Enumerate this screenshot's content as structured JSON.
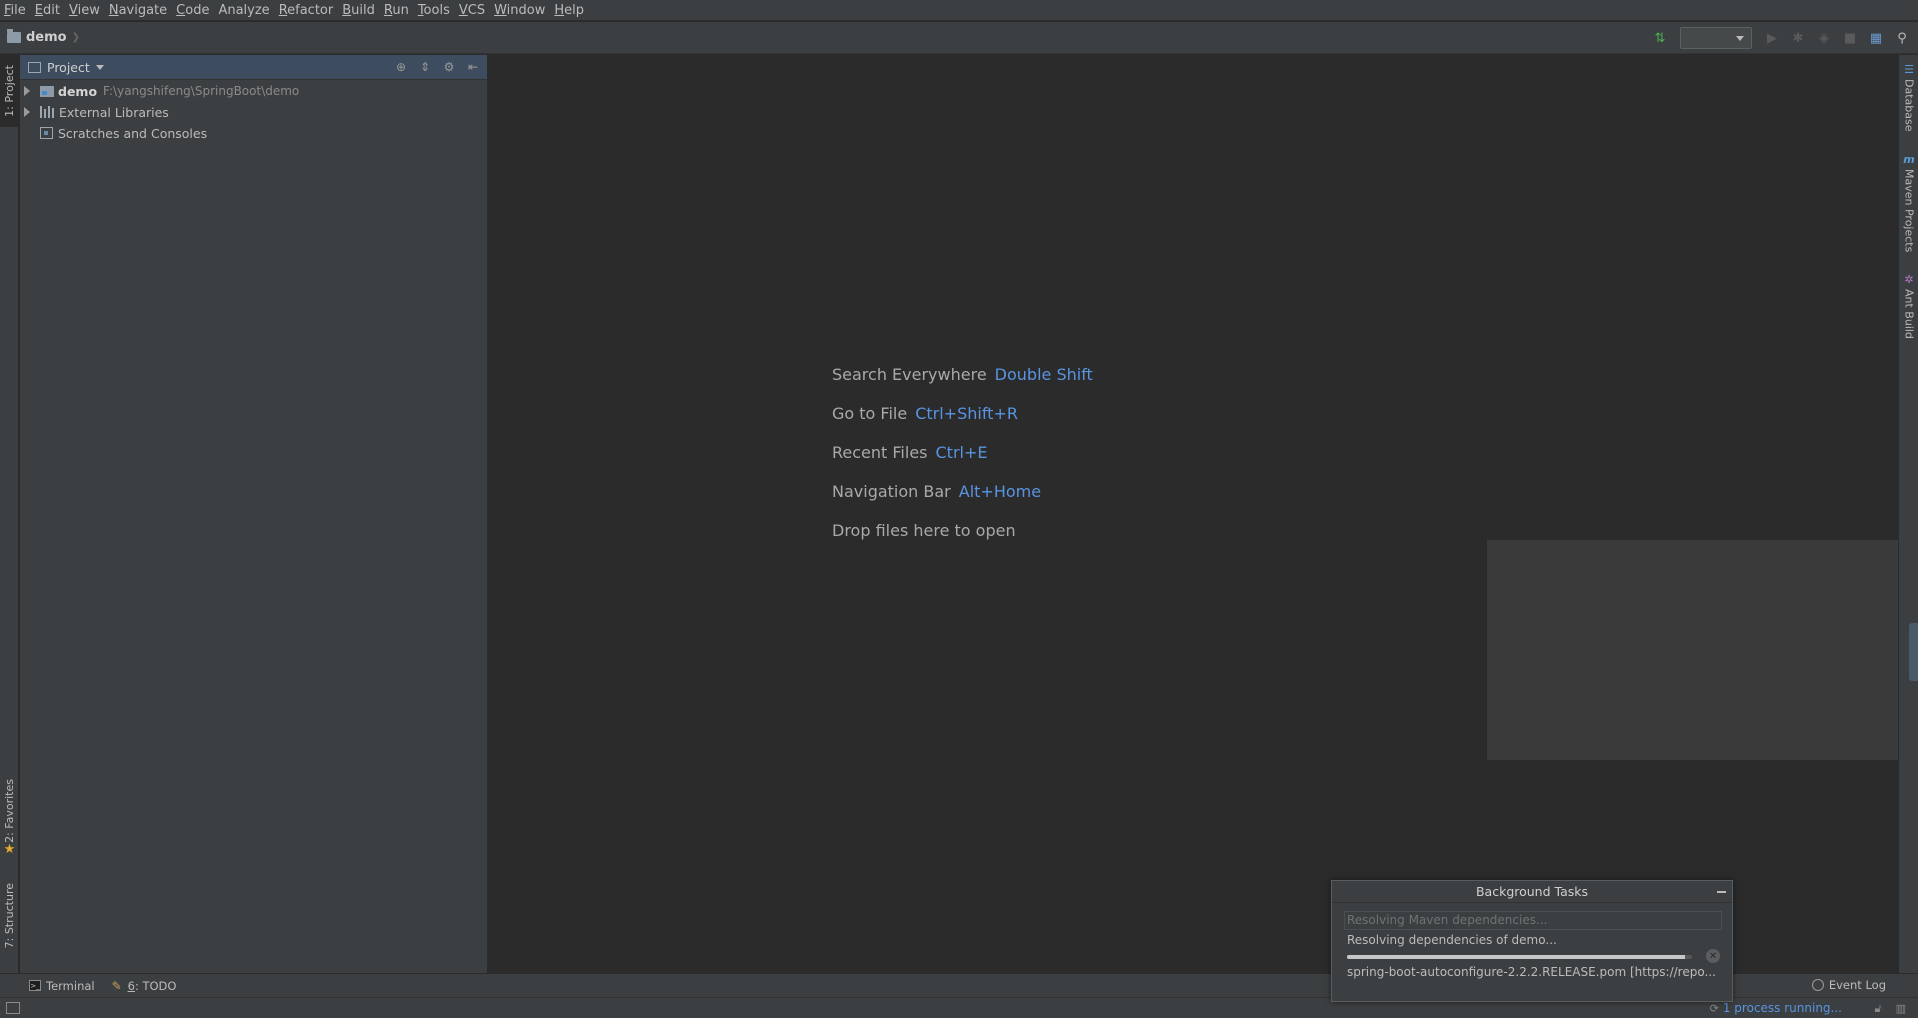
{
  "menu": {
    "items": [
      {
        "key": "F",
        "rest": "ile"
      },
      {
        "key": "E",
        "rest": "dit"
      },
      {
        "key": "V",
        "rest": "iew"
      },
      {
        "key": "N",
        "rest": "avigate"
      },
      {
        "key": "C",
        "rest": "ode"
      },
      {
        "key": "",
        "rest": "Analyze"
      },
      {
        "key": "R",
        "rest": "efactor"
      },
      {
        "key": "B",
        "rest": "uild"
      },
      {
        "key": "R",
        "rest": "un"
      },
      {
        "key": "T",
        "rest": "ools"
      },
      {
        "key": "V",
        "rest": "CS"
      },
      {
        "key": "W",
        "rest": "indow"
      },
      {
        "key": "H",
        "rest": "elp"
      }
    ]
  },
  "navbar": {
    "crumb": "demo",
    "run_config_value": "",
    "icons": [
      "build-icon",
      "run-icon",
      "debug-icon",
      "coverage-icon",
      "stop-icon",
      "project-structure-icon",
      "search-icon"
    ]
  },
  "left_stripe": {
    "project": "1: Project",
    "favorites": "2: Favorites",
    "structure": "7: Structure"
  },
  "project_panel": {
    "title": "Project",
    "tree": [
      {
        "label": "demo",
        "path": "F:\\yangshifeng\\SpringBoot\\demo",
        "expandable": true
      },
      {
        "label": "External Libraries",
        "path": "",
        "expandable": true
      },
      {
        "label": "Scratches and Consoles",
        "path": "",
        "expandable": false
      }
    ]
  },
  "editor": {
    "hints": [
      {
        "text": "Search Everywhere",
        "key": "Double Shift"
      },
      {
        "text": "Go to File",
        "key": "Ctrl+Shift+R"
      },
      {
        "text": "Recent Files",
        "key": "Ctrl+E"
      },
      {
        "text": "Navigation Bar",
        "key": "Alt+Home"
      },
      {
        "text": "Drop files here to open",
        "key": ""
      }
    ]
  },
  "right_stripe": {
    "database": "Database",
    "maven": "Maven Projects",
    "ant": "Ant Build"
  },
  "bottom_stripe": {
    "terminal": "Terminal",
    "todo_key": "6",
    "todo_rest": ": TODO",
    "event_log": "Event Log"
  },
  "status": {
    "progress_text": "1 process running..."
  },
  "background_tasks": {
    "title": "Background Tasks",
    "line1": "Resolving Maven dependencies...",
    "line2": "Resolving dependencies of demo...",
    "progress": 0.98,
    "line3": "spring-boot-autoconfigure-2.2.2.RELEASE.pom [https://repo..."
  },
  "colors": {
    "accent": "#5894e0",
    "background": "#2b2b2b",
    "panel": "#3c3f41"
  }
}
